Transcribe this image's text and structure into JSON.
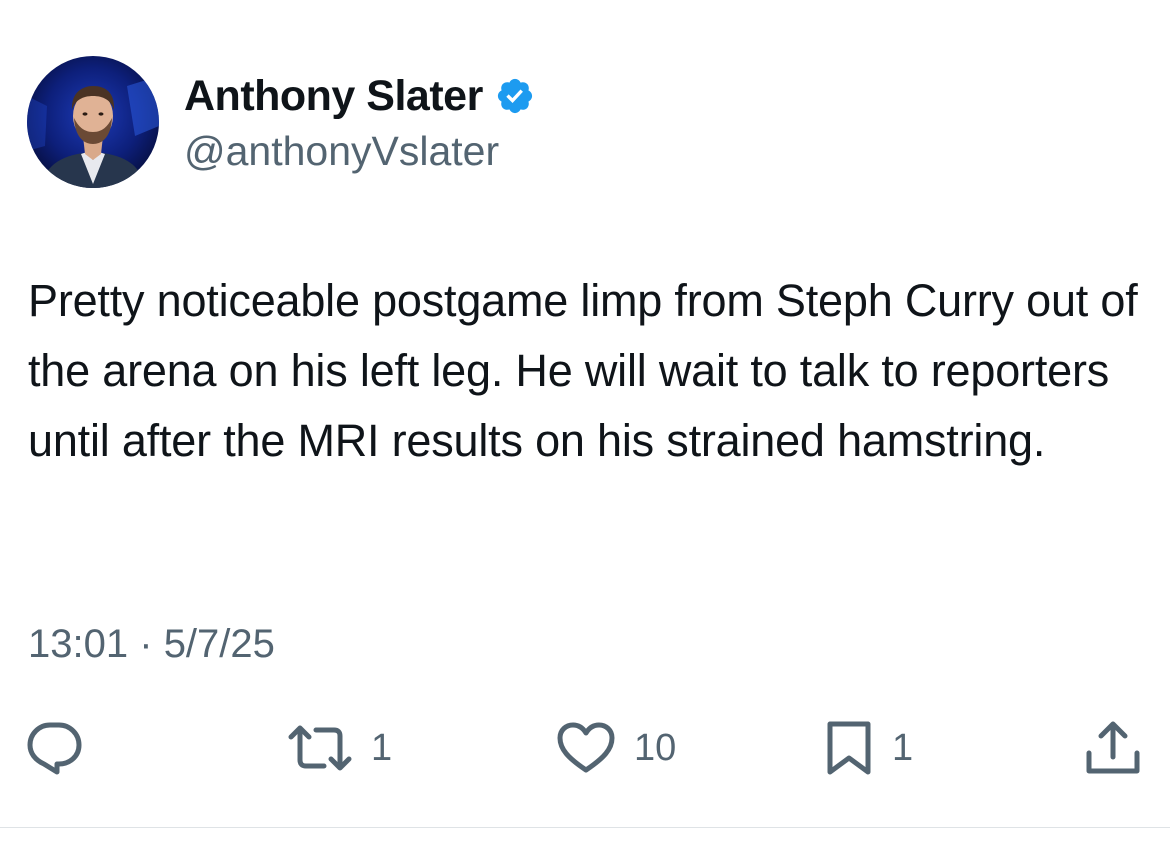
{
  "author": {
    "display_name": "Anthony Slater",
    "handle": "@anthonyVslater",
    "verified": true,
    "avatar_icon": "profile-photo",
    "verified_icon": "verified-badge-icon",
    "verified_color": "#1d9bf0"
  },
  "tweet": {
    "text": "Pretty noticeable postgame limp from Steph Curry out of the arena on his left leg. He will wait to talk to reporters until after the MRI results on his strained hamstring.",
    "time": "13:01",
    "separator": "·",
    "date": "5/7/25"
  },
  "actions": {
    "reply": {
      "icon": "reply-icon",
      "count": ""
    },
    "retweet": {
      "icon": "retweet-icon",
      "count": "1"
    },
    "like": {
      "icon": "heart-icon",
      "count": "10"
    },
    "bookmark": {
      "icon": "bookmark-icon",
      "count": "1"
    },
    "share": {
      "icon": "share-icon"
    }
  },
  "colors": {
    "text": "#0f1419",
    "secondary_text": "#536471",
    "accent": "#1d9bf0"
  }
}
